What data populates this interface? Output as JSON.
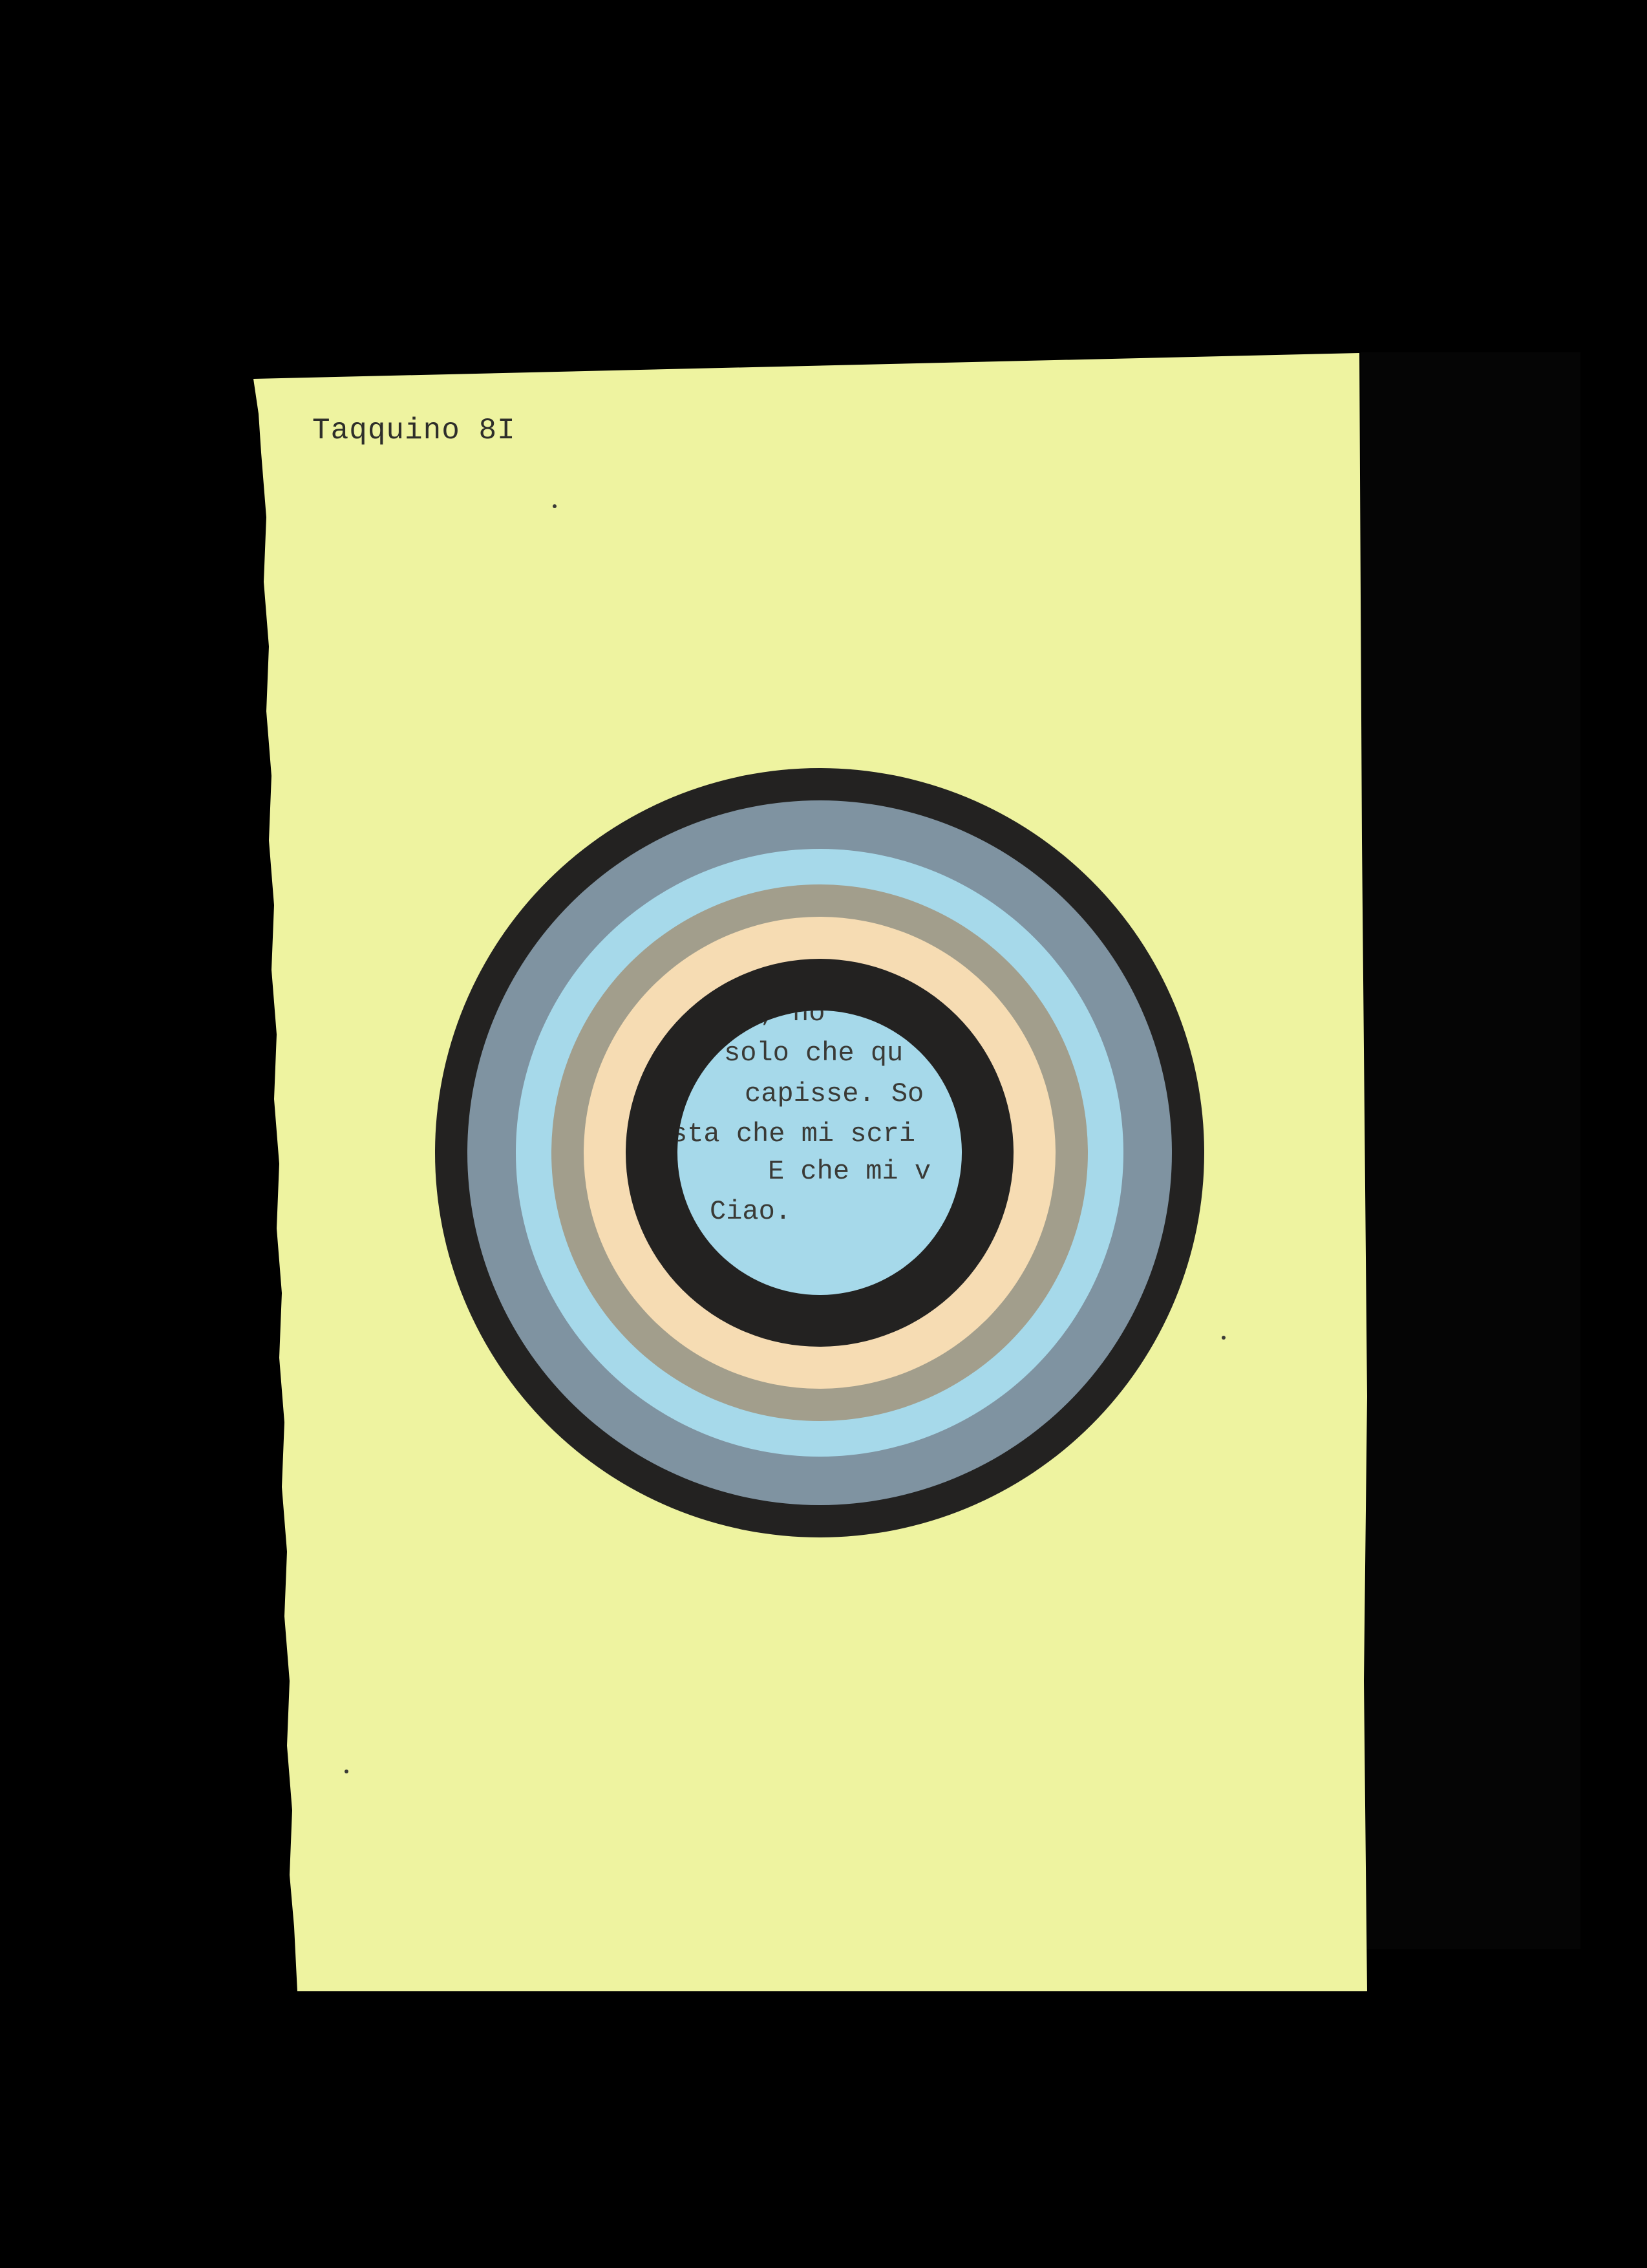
{
  "cover": {
    "title": "Taqquino 8I",
    "inner_text_lines": [
      "ice, no",
      "solo che qu",
      "capisse. So",
      "sta che mi scri",
      "E che mi v",
      "Ciao."
    ]
  },
  "colors": {
    "background": "#000000",
    "paper": "#eef3a0",
    "ring_outer": "#232221",
    "ring_slate": "#7f93a1",
    "ring_sky": "#a6d9ea",
    "ring_taupe": "#a29e8c",
    "ring_peach": "#f6dcb3",
    "ring_inner": "#232221",
    "center": "#a6d9ea",
    "ink": "#3a3a36"
  },
  "icons": [
    "concentric-rings-graphic"
  ]
}
